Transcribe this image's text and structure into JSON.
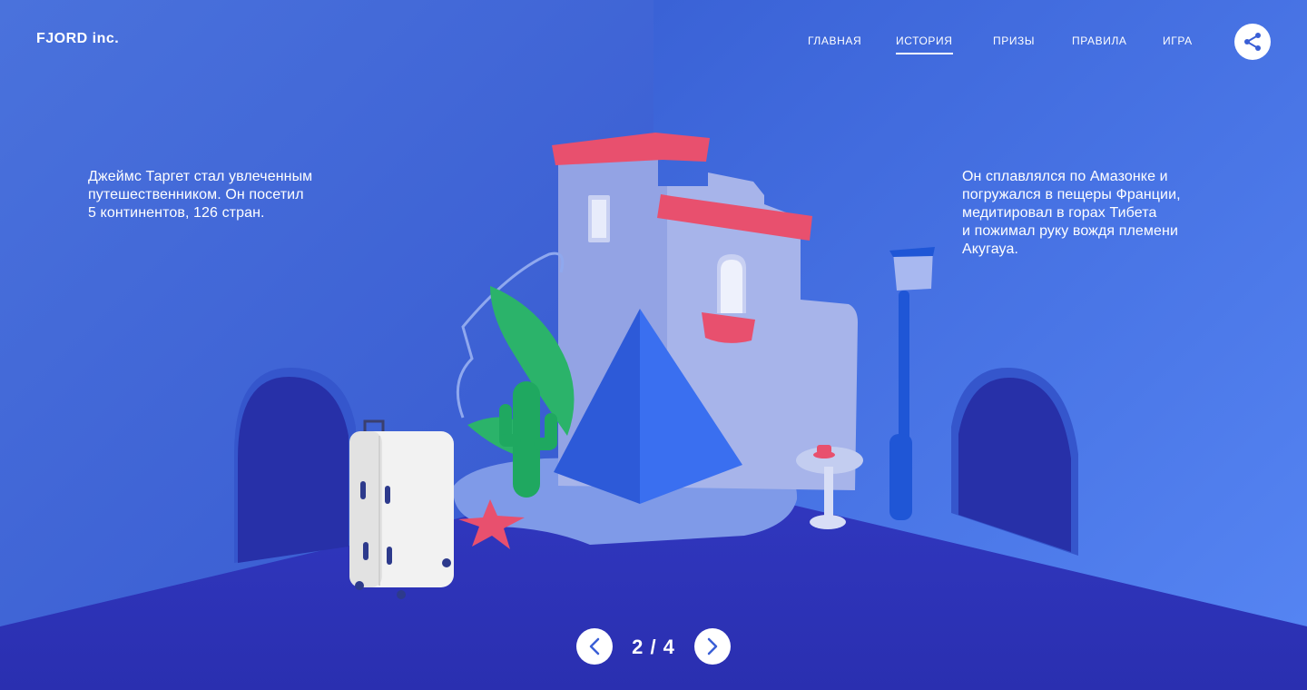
{
  "header": {
    "logo": "FJORD inc.",
    "nav": [
      {
        "label": "ГЛАВНАЯ",
        "active": false
      },
      {
        "label": "ИСТОРИЯ",
        "active": true
      },
      {
        "label": "ПРИЗЫ",
        "active": false
      },
      {
        "label": "ПРАВИЛА",
        "active": false
      },
      {
        "label": "ИГРА",
        "active": false
      }
    ],
    "share_icon": "share-icon"
  },
  "story": {
    "left_text": "Джеймс Таргет стал увлеченным\nпутешественником. Он посетил\n5 континентов, 126 стран.",
    "right_text": "Он сплавлялся по Амазонке и\nпогружался в пещеры Франции,\nмедитировал в горах Тибета\nи пожимал руку вождя племени\nАкугауа."
  },
  "pager": {
    "counter": "2 / 4",
    "prev_icon": "chevron-left-icon",
    "next_icon": "chevron-right-icon"
  },
  "colors": {
    "accent": "#3a5fd6",
    "roof": "#e8506e",
    "floor": "#2e35b8",
    "white": "#ffffff"
  }
}
